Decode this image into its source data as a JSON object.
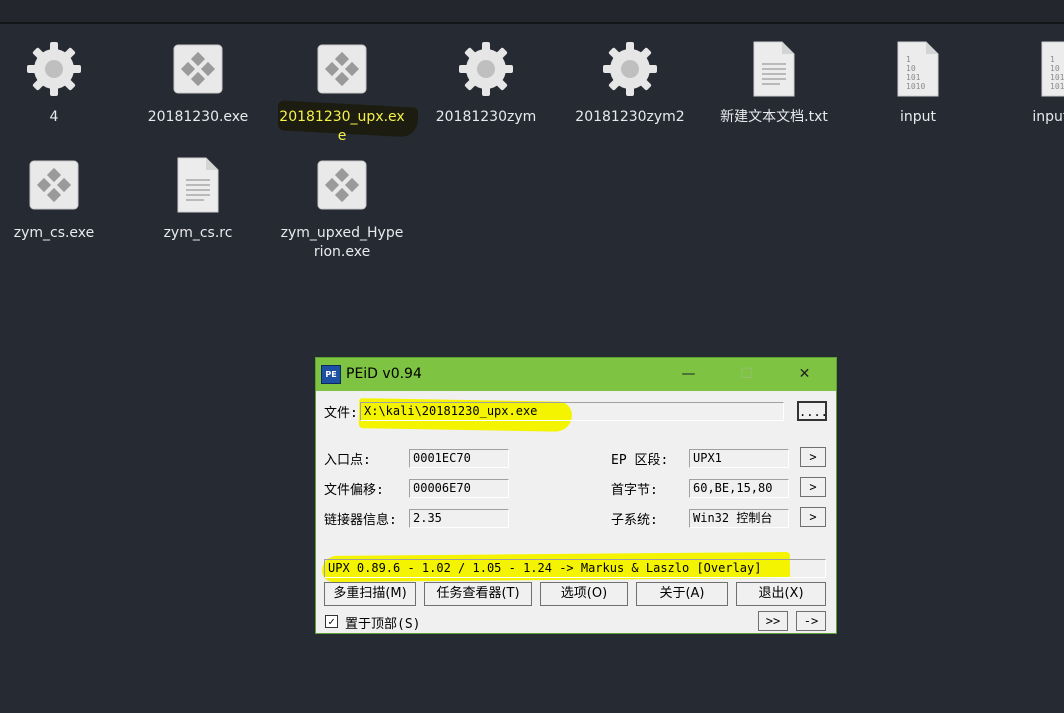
{
  "desktop": {
    "files": [
      {
        "name": "4",
        "icon": "gear-icon"
      },
      {
        "name": "20181230.exe",
        "icon": "exe-icon"
      },
      {
        "name": "20181230_upx.exe",
        "icon": "exe-icon",
        "highlighted": true
      },
      {
        "name": "20181230zym",
        "icon": "gear-icon"
      },
      {
        "name": "20181230zym2",
        "icon": "gear-icon"
      },
      {
        "name": "新建文本文档.txt",
        "icon": "text-file-icon"
      },
      {
        "name": "input",
        "icon": "binary-file-icon"
      },
      {
        "name": "input_sh",
        "icon": "binary-file-icon"
      },
      {
        "name": "zym_cs.exe",
        "icon": "exe-icon"
      },
      {
        "name": "zym_cs.rc",
        "icon": "text-file-icon"
      },
      {
        "name": "zym_upxed_Hyperion.exe",
        "icon": "exe-icon"
      }
    ],
    "colors": {
      "background": "#262a33",
      "label": "#e9eaee",
      "highlight_text": "#f6f24a"
    }
  },
  "peid": {
    "title": "PEiD v0.94",
    "icon_text": "PE",
    "controls": {
      "minimize": "—",
      "maximize": "☐",
      "close": "✕"
    },
    "file_label": "文件:",
    "file_value": "X:\\kali\\20181230_upx.exe",
    "browse_label": "....",
    "entry_point_label": "入口点:",
    "entry_point_value": "0001EC70",
    "file_offset_label": "文件偏移:",
    "file_offset_value": "00006E70",
    "linker_info_label": "链接器信息:",
    "linker_info_value": "2.35",
    "ep_section_label": "EP 区段:",
    "ep_section_value": "UPX1",
    "first_bytes_label": "首字节:",
    "first_bytes_value": "60,BE,15,80",
    "subsystem_label": "子系统:",
    "subsystem_value": "Win32 控制台",
    "arrow_label": ">",
    "result": "UPX 0.89.6 - 1.02 / 1.05 - 1.24 -> Markus & Laszlo [Overlay]",
    "buttons": {
      "multi_scan": "多重扫描(M)",
      "task_viewer": "任务查看器(T)",
      "options": "选项(O)",
      "about": "关于(A)",
      "exit": "退出(X)"
    },
    "stay_on_top_label": "置于顶部(S)",
    "stay_on_top_checked": "✓",
    "ext_button": ">>",
    "next_button": "->",
    "colors": {
      "titlebar": "#7ec341",
      "window": "#f0f0f0",
      "highlight": "#f4f400"
    }
  }
}
